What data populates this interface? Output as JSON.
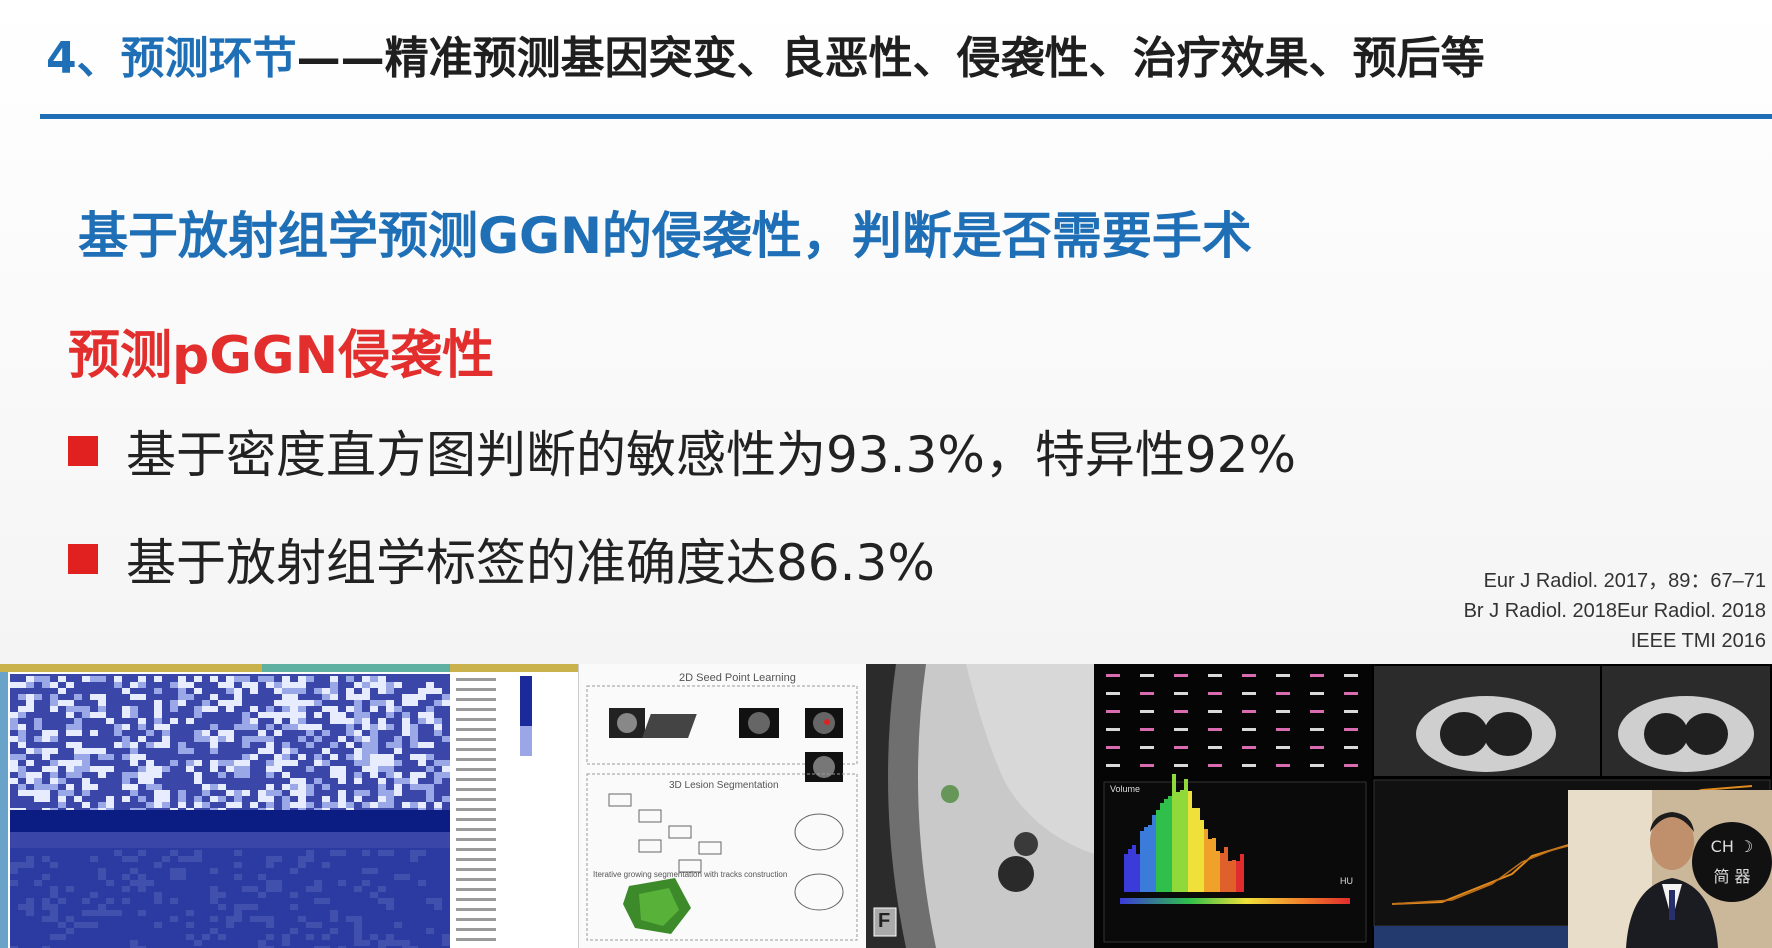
{
  "header": {
    "number": "4、",
    "title_blue": "预测环节",
    "title_black": "——精准预测基因突变、良恶性、侵袭性、治疗效果、预后等"
  },
  "subtitle": "基于放射组学预测GGN的侵袭性，判断是否需要手术",
  "section_title": "预测pGGN侵袭性",
  "bullets": [
    "基于密度直方图判断的敏感性为93.3%，特异性92%",
    "基于放射组学标签的准确度达86.3%"
  ],
  "references": [
    "Eur J Radiol. 2017，89：67–71",
    "Br J Radiol. 2018Eur Radiol. 2018",
    "IEEE TMI 2016"
  ],
  "panels": {
    "workflow_title": "2D Seed Point Learning",
    "workflow_subtitle": "3D Lesion Segmentation",
    "workflow_caption": "Iterative growing segmentation with tracks construction",
    "scan_label": "F",
    "histogram_title": "Volume",
    "histogram_xlabel": "HU"
  },
  "camera_widget": {
    "line1": "CH ☽",
    "line2": "简 器"
  },
  "colors": {
    "accent_blue": "#1f6fb6",
    "accent_red": "#e32e2e",
    "bullet_red": "#e12020"
  }
}
